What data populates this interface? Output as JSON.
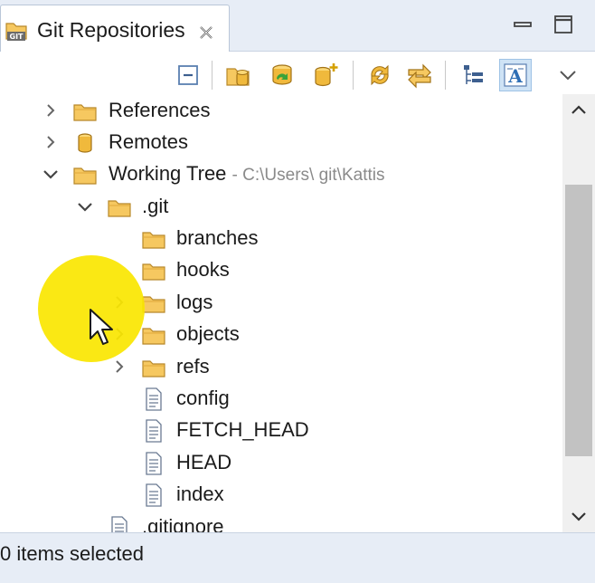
{
  "tab": {
    "title": "Git Repositories",
    "icon": "git-repositories-icon",
    "close_icon": "close-icon"
  },
  "window_buttons": [
    "minimize-icon",
    "maximize-icon"
  ],
  "toolbar": {
    "buttons": [
      "collapse-all-icon",
      "add-existing-repository-icon",
      "clone-repository-icon",
      "create-repository-icon",
      "refresh-icon",
      "link-with-selection-icon",
      "hierarchical-branch-layout-icon",
      "show-label-icon",
      "view-menu-icon"
    ]
  },
  "tree": {
    "rows": [
      {
        "label": "References",
        "expanded": false,
        "icon": "folder-icon",
        "depth": 0
      },
      {
        "label": "Remotes",
        "expanded": false,
        "icon": "remote-icon",
        "depth": 0
      },
      {
        "label": "Working Tree",
        "path": "C:\\Users\\ git\\Kattis",
        "expanded": true,
        "icon": "folder-icon",
        "depth": 0
      },
      {
        "label": ".git",
        "expanded": true,
        "icon": "folder-icon",
        "depth": 1
      },
      {
        "label": "branches",
        "icon": "folder-icon",
        "depth": 2
      },
      {
        "label": "hooks",
        "icon": "folder-icon",
        "depth": 2
      },
      {
        "label": "logs",
        "expanded": false,
        "icon": "folder-icon",
        "depth": 2
      },
      {
        "label": "objects",
        "expanded": false,
        "icon": "folder-icon",
        "depth": 2
      },
      {
        "label": "refs",
        "expanded": false,
        "icon": "folder-icon",
        "depth": 2
      },
      {
        "label": "config",
        "icon": "file-icon",
        "depth": 2
      },
      {
        "label": "FETCH_HEAD",
        "icon": "file-icon",
        "depth": 2
      },
      {
        "label": "HEAD",
        "icon": "file-icon",
        "depth": 2
      },
      {
        "label": "index",
        "icon": "file-icon",
        "depth": 2
      },
      {
        "label": ".gitignore",
        "icon": "file-icon",
        "depth": 1
      }
    ]
  },
  "status": {
    "text": "0 items selected"
  },
  "colors": {
    "chrome": "#e7edf6",
    "folder": "#f6c860",
    "accent": "#2f6fb5",
    "highlight": "#fae600"
  }
}
